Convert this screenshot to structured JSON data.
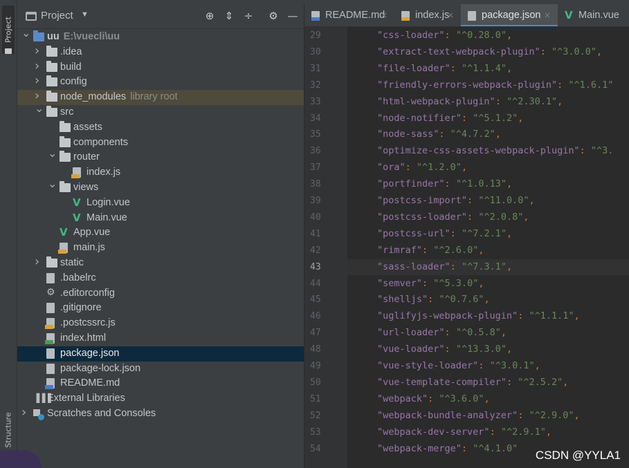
{
  "tool_strip": {
    "project_tab": "Project",
    "structure_tab": "Structure"
  },
  "project_panel": {
    "title": "Project",
    "tree": [
      {
        "label": "uu",
        "hint": "E:\\vuecli\\uu",
        "depth": 0,
        "arrow": "down",
        "icon": "folder-blue"
      },
      {
        "label": ".idea",
        "depth": 1,
        "arrow": "right",
        "icon": "folder"
      },
      {
        "label": "build",
        "depth": 1,
        "arrow": "right",
        "icon": "folder"
      },
      {
        "label": "config",
        "depth": 1,
        "arrow": "right",
        "icon": "folder"
      },
      {
        "label": "node_modules",
        "hint": "library root",
        "depth": 1,
        "arrow": "right",
        "icon": "folder",
        "state": "library"
      },
      {
        "label": "src",
        "depth": 1,
        "arrow": "down",
        "icon": "folder"
      },
      {
        "label": "assets",
        "depth": 2,
        "arrow": "",
        "icon": "folder"
      },
      {
        "label": "components",
        "depth": 2,
        "arrow": "",
        "icon": "folder"
      },
      {
        "label": "router",
        "depth": 2,
        "arrow": "down",
        "icon": "folder"
      },
      {
        "label": "index.js",
        "depth": 3,
        "arrow": "",
        "icon": "js"
      },
      {
        "label": "views",
        "depth": 2,
        "arrow": "down",
        "icon": "folder"
      },
      {
        "label": "Login.vue",
        "depth": 3,
        "arrow": "",
        "icon": "vue"
      },
      {
        "label": "Main.vue",
        "depth": 3,
        "arrow": "",
        "icon": "vue"
      },
      {
        "label": "App.vue",
        "depth": 2,
        "arrow": "",
        "icon": "vue"
      },
      {
        "label": "main.js",
        "depth": 2,
        "arrow": "",
        "icon": "js"
      },
      {
        "label": "static",
        "depth": 1,
        "arrow": "right",
        "icon": "folder"
      },
      {
        "label": ".babelrc",
        "depth": 1,
        "arrow": "",
        "icon": "file"
      },
      {
        "label": ".editorconfig",
        "depth": 1,
        "arrow": "",
        "icon": "gear"
      },
      {
        "label": ".gitignore",
        "depth": 1,
        "arrow": "",
        "icon": "file"
      },
      {
        "label": ".postcssrc.js",
        "depth": 1,
        "arrow": "",
        "icon": "js"
      },
      {
        "label": "index.html",
        "depth": 1,
        "arrow": "",
        "icon": "html"
      },
      {
        "label": "package.json",
        "depth": 1,
        "arrow": "",
        "icon": "file",
        "state": "selected"
      },
      {
        "label": "package-lock.json",
        "depth": 1,
        "arrow": "",
        "icon": "file"
      },
      {
        "label": "README.md",
        "depth": 1,
        "arrow": "",
        "icon": "md"
      },
      {
        "label": "External Libraries",
        "depth": 0,
        "arrow": "",
        "icon": "libraries"
      },
      {
        "label": "Scratches and Consoles",
        "depth": 0,
        "arrow": "right",
        "icon": "scratches"
      }
    ]
  },
  "tabs": [
    {
      "label": "README.md",
      "icon": "md",
      "active": false
    },
    {
      "label": "index.js",
      "icon": "js",
      "active": false
    },
    {
      "label": "package.json",
      "icon": "file",
      "active": true
    },
    {
      "label": "Main.vue",
      "icon": "vue",
      "active": false
    }
  ],
  "editor": {
    "current_line": 43,
    "lines": [
      {
        "num": "29",
        "key": "\"css-loader\"",
        "value": "\"^0.28.0\"",
        "comma": ","
      },
      {
        "num": "30",
        "key": "\"extract-text-webpack-plugin\"",
        "value": "\"^3.0.0\"",
        "comma": ","
      },
      {
        "num": "31",
        "key": "\"file-loader\"",
        "value": "\"^1.1.4\"",
        "comma": ","
      },
      {
        "num": "32",
        "key": "\"friendly-errors-webpack-plugin\"",
        "value": "\"^1.6.1\"",
        "comma": ""
      },
      {
        "num": "33",
        "key": "\"html-webpack-plugin\"",
        "value": "\"^2.30.1\"",
        "comma": ","
      },
      {
        "num": "34",
        "key": "\"node-notifier\"",
        "value": "\"^5.1.2\"",
        "comma": ","
      },
      {
        "num": "35",
        "key": "\"node-sass\"",
        "value": "\"^4.7.2\"",
        "comma": ","
      },
      {
        "num": "36",
        "key": "\"optimize-css-assets-webpack-plugin\"",
        "value": "\"^3.",
        "comma": ""
      },
      {
        "num": "37",
        "key": "\"ora\"",
        "value": "\"^1.2.0\"",
        "comma": ","
      },
      {
        "num": "38",
        "key": "\"portfinder\"",
        "value": "\"^1.0.13\"",
        "comma": ","
      },
      {
        "num": "39",
        "key": "\"postcss-import\"",
        "value": "\"^11.0.0\"",
        "comma": ","
      },
      {
        "num": "40",
        "key": "\"postcss-loader\"",
        "value": "\"^2.0.8\"",
        "comma": ","
      },
      {
        "num": "41",
        "key": "\"postcss-url\"",
        "value": "\"^7.2.1\"",
        "comma": ","
      },
      {
        "num": "42",
        "key": "\"rimraf\"",
        "value": "\"^2.6.0\"",
        "comma": ","
      },
      {
        "num": "43",
        "key": "\"sass-loader\"",
        "value": "\"^7.3.1\"",
        "comma": ","
      },
      {
        "num": "44",
        "key": "\"semver\"",
        "value": "\"^5.3.0\"",
        "comma": ","
      },
      {
        "num": "45",
        "key": "\"shelljs\"",
        "value": "\"^0.7.6\"",
        "comma": ","
      },
      {
        "num": "46",
        "key": "\"uglifyjs-webpack-plugin\"",
        "value": "\"^1.1.1\"",
        "comma": ","
      },
      {
        "num": "47",
        "key": "\"url-loader\"",
        "value": "\"^0.5.8\"",
        "comma": ","
      },
      {
        "num": "48",
        "key": "\"vue-loader\"",
        "value": "\"^13.3.0\"",
        "comma": ","
      },
      {
        "num": "49",
        "key": "\"vue-style-loader\"",
        "value": "\"^3.0.1\"",
        "comma": ","
      },
      {
        "num": "50",
        "key": "\"vue-template-compiler\"",
        "value": "\"^2.5.2\"",
        "comma": ","
      },
      {
        "num": "51",
        "key": "\"webpack\"",
        "value": "\"^3.6.0\"",
        "comma": ","
      },
      {
        "num": "52",
        "key": "\"webpack-bundle-analyzer\"",
        "value": "\"^2.9.0\"",
        "comma": ","
      },
      {
        "num": "53",
        "key": "\"webpack-dev-server\"",
        "value": "\"^2.9.1\"",
        "comma": ","
      },
      {
        "num": "54",
        "key": "\"webpack-merge\"",
        "value": "\"^4.1.0\"",
        "comma": ""
      }
    ]
  },
  "watermark": "CSDN @YYLA1",
  "colors": {
    "panel_bg": "#3c3f41",
    "editor_bg": "#2b2b2b",
    "selection": "#0d293e",
    "json_key": "#9876aa",
    "json_string": "#6a8759",
    "vue_green": "#41b883"
  }
}
